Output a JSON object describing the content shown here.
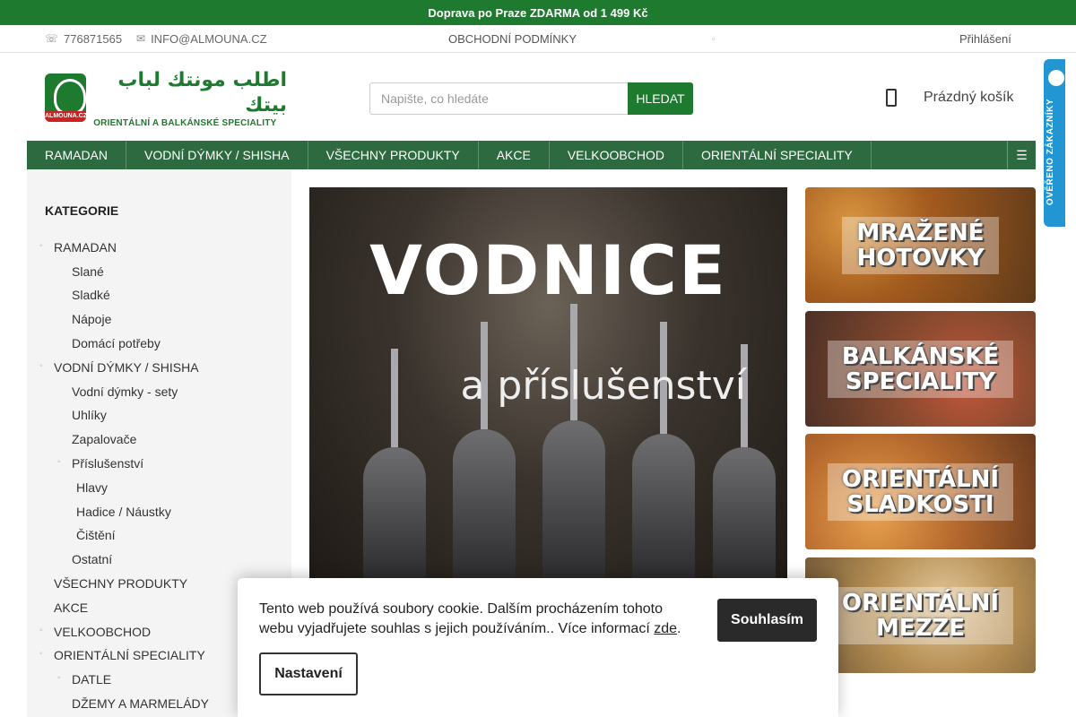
{
  "promo_bar": {
    "text": "Doprava po Praze ZDARMA od 1 499 Kč"
  },
  "top_bar": {
    "phone": "776871565",
    "email": "INFO@ALMOUNA.CZ",
    "terms_link": "OBCHODNÍ PODMÍNKY",
    "login_link": "Přihlášení",
    "phone_icon": "phone-icon",
    "email_icon": "envelope-icon"
  },
  "logo": {
    "arabic_text": "اطلب مونتك لباب بيتك",
    "tagline": "ORIENTÁLNÍ A BALKÁNSKÉ SPECIALITY",
    "badge_text": "ALMOUNA.CZ"
  },
  "search": {
    "placeholder": "Napište, co hledáte",
    "button_label": "HLEDAT"
  },
  "cart": {
    "label": "Prázdný košík",
    "icon": "shopping-bag-icon"
  },
  "nav": {
    "items": [
      {
        "label": "RAMADAN"
      },
      {
        "label": "VODNÍ DÝMKY / SHISHA"
      },
      {
        "label": "VŠECHNY PRODUKTY"
      },
      {
        "label": "AKCE"
      },
      {
        "label": "VELKOOBCHOD"
      },
      {
        "label": "ORIENTÁLNÍ SPECIALITY"
      }
    ],
    "more_icon": "menu-icon"
  },
  "trust_badge": {
    "text": "OVĚŘENO ZÁKAZNÍKY"
  },
  "sidebar": {
    "title": "KATEGORIE",
    "categories": [
      {
        "label": "RAMADAN"
      },
      {
        "label": "Slané"
      },
      {
        "label": "Sladké"
      },
      {
        "label": "Nápoje"
      },
      {
        "label": "Domácí potřeby"
      },
      {
        "label": "VODNÍ DÝMKY / SHISHA"
      },
      {
        "label": "Vodní dýmky - sety"
      },
      {
        "label": "Uhlíky"
      },
      {
        "label": "Zapalovače"
      },
      {
        "label": "Příslušenství"
      },
      {
        "label": "Hlavy"
      },
      {
        "label": "Hadice / Náustky"
      },
      {
        "label": "Čištění"
      },
      {
        "label": "Ostatní"
      },
      {
        "label": "VŠECHNY PRODUKTY"
      },
      {
        "label": "AKCE"
      },
      {
        "label": "VELKOOBCHOD"
      },
      {
        "label": "ORIENTÁLNÍ SPECIALITY"
      },
      {
        "label": "DATLE"
      },
      {
        "label": "DŽEMY A MARMELÁDY"
      }
    ]
  },
  "hero": {
    "title": "VODNICE",
    "subtitle": "a příslušenství"
  },
  "promo_tiles": [
    {
      "label": "MRAŽENÉ\nHOTOVKY"
    },
    {
      "label": "BALKÁNSKÉ\nSPECIALITY"
    },
    {
      "label": "ORIENTÁLNÍ\nSLADKOSTI"
    },
    {
      "label": "ORIENTÁLNÍ\nMEZZE"
    }
  ],
  "cookie_banner": {
    "text": "Tento web používá soubory cookie. Dalším procházením tohoto webu vyjadřujete souhlas s jejich používáním.. Více informací",
    "link_text": "zde",
    "after_link": ".",
    "agree_label": "Souhlasím",
    "settings_label": "Nastavení"
  }
}
